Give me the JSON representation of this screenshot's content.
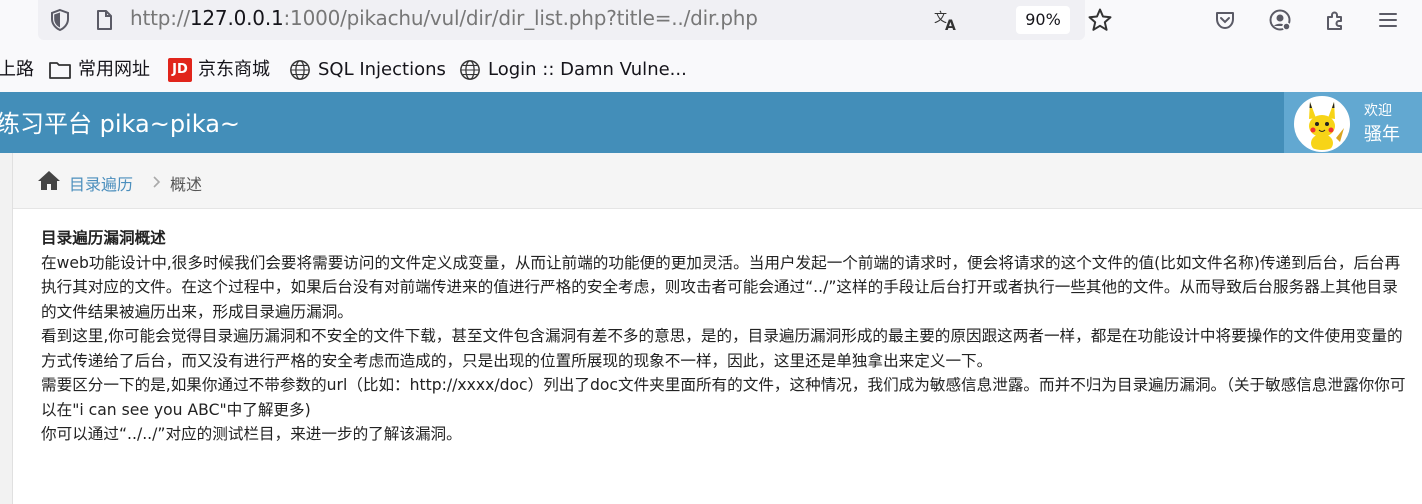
{
  "browser": {
    "url_host": "127.0.0.1",
    "url_rest": ":1000/pikachu/vul/dir/dir_list.php?title=../dir.php",
    "url_scheme": "http://",
    "zoom": "90%",
    "bookmarks": [
      {
        "label": "上路",
        "icon": "none"
      },
      {
        "label": "常用网址",
        "icon": "folder-icon"
      },
      {
        "label": "京东商城",
        "icon": "jd-icon"
      },
      {
        "label": "SQL Injections",
        "icon": "globe-icon"
      },
      {
        "label": "Login :: Damn Vulne...",
        "icon": "globe-icon"
      }
    ]
  },
  "header": {
    "title": "练习平台 pika~pika~",
    "welcome": "欢迎",
    "username": "骚年",
    "bg_color": "#438eb9"
  },
  "breadcrumb": {
    "link": "目录遍历",
    "current": "概述"
  },
  "article": {
    "heading": "目录遍历漏洞概述",
    "paragraphs": [
      "在web功能设计中,很多时候我们会要将需要访问的文件定义成变量，从而让前端的功能便的更加灵活。当用户发起一个前端的请求时，便会将请求的这个文件的值(比如文件名称)传递到后台，后台再执行其对应的文件。在这个过程中，如果后台没有对前端传进来的值进行严格的安全考虑，则攻击者可能会通过“../”这样的手段让后台打开或者执行一些其他的文件。从而导致后台服务器上其他目录的文件结果被遍历出来，形成目录遍历漏洞。",
      "看到这里,你可能会觉得目录遍历漏洞和不安全的文件下载，甚至文件包含漏洞有差不多的意思，是的，目录遍历漏洞形成的最主要的原因跟这两者一样，都是在功能设计中将要操作的文件使用变量的方式传递给了后台，而又没有进行严格的安全考虑而造成的，只是出现的位置所展现的现象不一样，因此，这里还是单独拿出来定义一下。",
      "需要区分一下的是,如果你通过不带参数的url（比如：http://xxxx/doc）列出了doc文件夹里面所有的文件，这种情况，我们成为敏感信息泄露。而并不归为目录遍历漏洞。（关于敏感信息泄露你你可以在\"i can see you ABC\"中了解更多)",
      "你可以通过“../../”对应的测试栏目，来进一步的了解该漏洞。"
    ]
  }
}
